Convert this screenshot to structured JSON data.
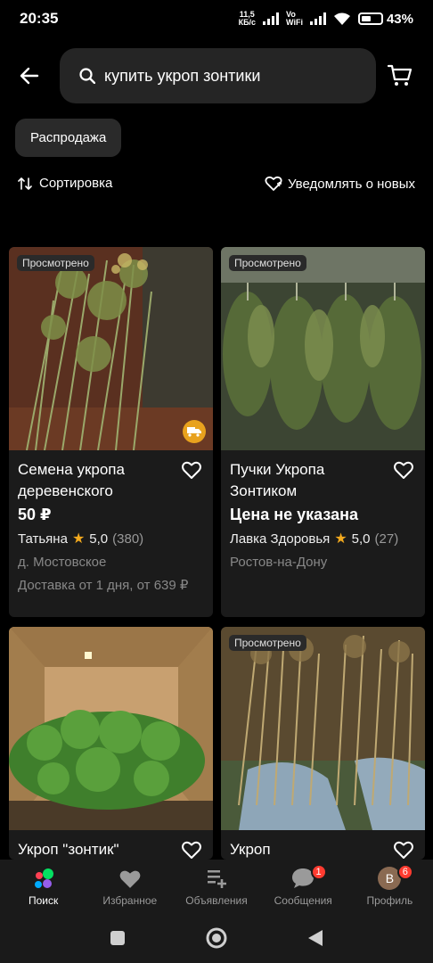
{
  "status_bar": {
    "time": "20:35",
    "net_speed_top": "11,5",
    "net_speed_bottom": "КБ/с",
    "vowifi_top": "Vo",
    "vowifi_bottom": "WiFi",
    "battery": "43%"
  },
  "search": {
    "query": "купить укроп зонтики"
  },
  "filters": {
    "chip": "Распродажа",
    "sort_label": "Сортировка",
    "notify_label": "Уведомлять о новых"
  },
  "cards": [
    {
      "seen_badge": "Просмотрено",
      "title": "Семена укропа деревенского",
      "price": "50 ₽",
      "seller": "Татьяна",
      "rating": "5,0",
      "reviews": "(380)",
      "location": "д. Мостовское",
      "delivery": "Доставка от 1 дня, от 639 ₽",
      "has_delivery_badge": true
    },
    {
      "seen_badge": "Просмотрено",
      "title": "Пучки Укропа Зонтиком",
      "price": "Цена не указана",
      "seller": "Лавка Здоровья",
      "rating": "5,0",
      "reviews": "(27)",
      "location": "Ростов-на-Дону"
    },
    {
      "title": "Укроп \"зонтик\""
    },
    {
      "seen_badge": "Просмотрено",
      "title": "Укроп"
    }
  ],
  "bottom_nav": {
    "search": "Поиск",
    "favorites": "Избранное",
    "ads": "Объявления",
    "messages": "Сообщения",
    "messages_badge": "1",
    "profile": "Профиль",
    "profile_badge": "6",
    "profile_initial": "В"
  },
  "colors": {
    "accent_star": "#f2a91e",
    "badge_red": "#ff3b30",
    "delivery_badge": "#e8a21e"
  }
}
